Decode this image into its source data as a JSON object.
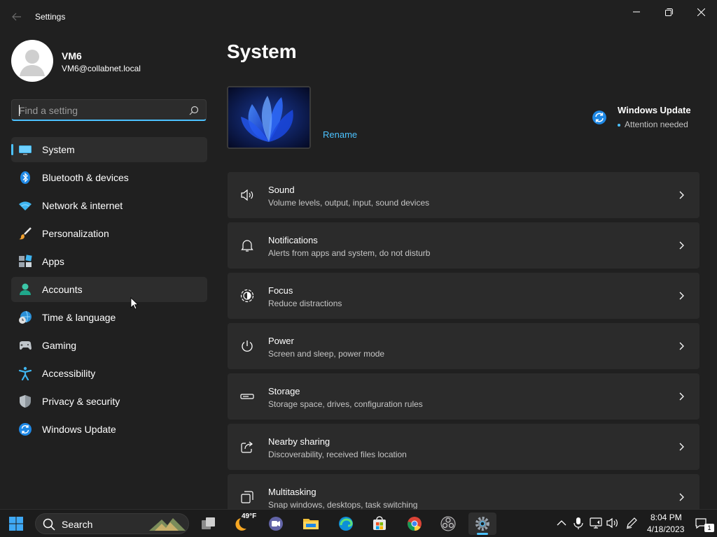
{
  "window": {
    "app_title": "Settings"
  },
  "profile": {
    "name": "VM6",
    "email": "VM6@collabnet.local"
  },
  "search": {
    "placeholder": "Find a setting"
  },
  "nav": {
    "items": [
      {
        "label": "System",
        "icon": "system-icon",
        "state": "selected"
      },
      {
        "label": "Bluetooth & devices",
        "icon": "bluetooth-icon"
      },
      {
        "label": "Network & internet",
        "icon": "wifi-icon"
      },
      {
        "label": "Personalization",
        "icon": "brush-icon"
      },
      {
        "label": "Apps",
        "icon": "apps-icon"
      },
      {
        "label": "Accounts",
        "icon": "person-icon",
        "state": "hover"
      },
      {
        "label": "Time & language",
        "icon": "globe-clock-icon"
      },
      {
        "label": "Gaming",
        "icon": "gamepad-icon"
      },
      {
        "label": "Accessibility",
        "icon": "accessibility-icon"
      },
      {
        "label": "Privacy & security",
        "icon": "shield-icon"
      },
      {
        "label": "Windows Update",
        "icon": "sync-icon"
      }
    ]
  },
  "main": {
    "title": "System",
    "rename_label": "Rename",
    "windows_update": {
      "title": "Windows Update",
      "status": "Attention needed"
    },
    "cards": [
      {
        "title": "Sound",
        "subtitle": "Volume levels, output, input, sound devices",
        "icon": "speaker-icon"
      },
      {
        "title": "Notifications",
        "subtitle": "Alerts from apps and system, do not disturb",
        "icon": "bell-icon"
      },
      {
        "title": "Focus",
        "subtitle": "Reduce distractions",
        "icon": "focus-icon"
      },
      {
        "title": "Power",
        "subtitle": "Screen and sleep, power mode",
        "icon": "power-icon"
      },
      {
        "title": "Storage",
        "subtitle": "Storage space, drives, configuration rules",
        "icon": "storage-icon"
      },
      {
        "title": "Nearby sharing",
        "subtitle": "Discoverability, received files location",
        "icon": "share-icon"
      },
      {
        "title": "Multitasking",
        "subtitle": "Snap windows, desktops, task switching",
        "icon": "multitasking-icon"
      }
    ]
  },
  "taskbar": {
    "search_label": "Search",
    "weather_temp": "49°F",
    "time": "8:04 PM",
    "date": "4/18/2023",
    "notification_count": "1"
  },
  "colors": {
    "accent": "#4cc2ff",
    "background": "#202020",
    "card": "#2b2b2b"
  }
}
